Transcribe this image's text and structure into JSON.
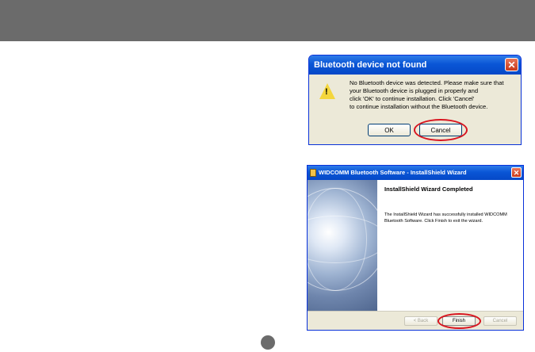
{
  "dialog_not_found": {
    "title": "Bluetooth device not found",
    "message_lines": [
      "No Bluetooth device was detected. Please make sure that",
      "your Bluetooth device is plugged in properly and",
      "click 'OK' to continue installation. Click 'Cancel'",
      "to continue installation without the Bluetooth device."
    ],
    "ok_label": "OK",
    "cancel_label": "Cancel",
    "close_glyph": "✕",
    "icon": "warning-icon"
  },
  "wizard": {
    "title": "WIDCOMM Bluetooth Software - InstallShield Wizard",
    "heading": "InstallShield Wizard Completed",
    "message_lines": [
      "The InstallShield Wizard has successfully installed WIDCOMM",
      "Bluetooth Software. Click Finish to exit the wizard."
    ],
    "back_label": "< Back",
    "finish_label": "Finish",
    "cancel_label": "Cancel",
    "close_glyph": "✕"
  },
  "highlight_color": "#d8141f",
  "header_color": "#6b6b6b"
}
